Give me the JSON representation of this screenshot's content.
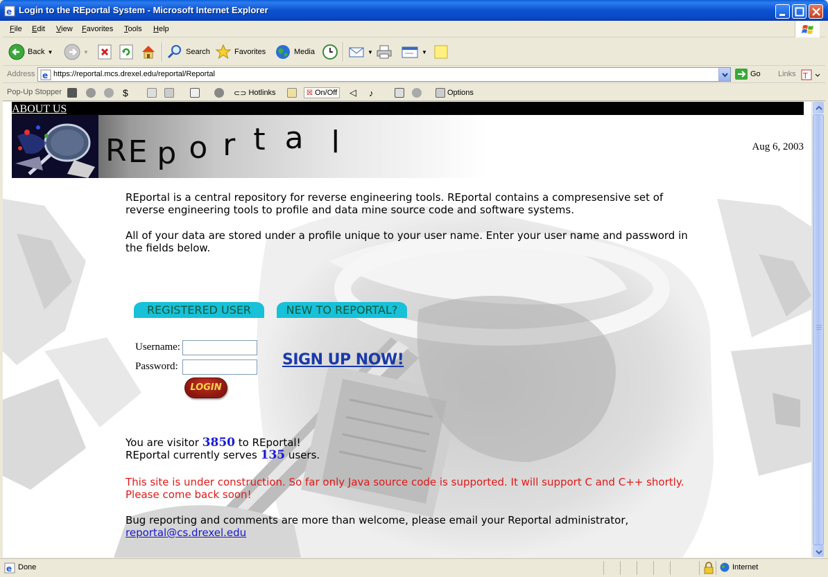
{
  "window": {
    "title": "Login to the REportal System - Microsoft Internet Explorer"
  },
  "menu": [
    "File",
    "Edit",
    "View",
    "Favorites",
    "Tools",
    "Help"
  ],
  "toolbar": {
    "back_label": "Back",
    "search_label": "Search",
    "favorites_label": "Favorites",
    "media_label": "Media"
  },
  "address": {
    "label": "Address",
    "url": "https://reportal.mcs.drexel.edu/reportal/Reportal",
    "go_label": "Go",
    "links_label": "Links"
  },
  "popup_bar": {
    "label": "Pop-Up Stopper",
    "hotlinks_label": "Hotlinks",
    "onoff_label": "On/Off",
    "options_label": "Options"
  },
  "page": {
    "about_link": "ABOUT US",
    "banner_letters": [
      "R",
      "E",
      "p",
      "o",
      "r",
      "t",
      "a",
      "l"
    ],
    "date": "Aug 6, 2003",
    "intro1": "REportal is a central repository for reverse engineering tools. REportal contains a compresensive set of reverse engineering tools to profile and data mine source code and software systems.",
    "intro2": "All of your data are stored under a profile unique to your user name. Enter your user name and password in the fields below.",
    "tab_registered": "REGISTERED USER",
    "tab_new": "NEW TO REPORTAL?",
    "username_label": "Username:",
    "password_label": "Password:",
    "username_value": "",
    "password_value": "",
    "login_label": "LOGIN",
    "signup_label": "SIGN UP NOW!",
    "visitor_prefix": "You are visitor ",
    "visitor_count": "3850",
    "visitor_suffix": " to REportal!",
    "users_prefix": "REportal currently serves ",
    "users_count": "135",
    "users_suffix": " users.",
    "warning": "This site is under construction. So far only Java source code is supported. It will support C and C++ shortly. Please come back soon!",
    "bug_text": "Bug reporting and comments are more than welcome, please email your Reportal administrator,",
    "email": "reportal@cs.drexel.edu"
  },
  "status": {
    "text": "Done",
    "zone": "Internet"
  },
  "colors": {
    "tab_bg": "#18c0d8",
    "tab_text": "#0d5a3c",
    "warning": "#e01818",
    "count": "#1818d8",
    "signup": "#1a3aa8",
    "login_bg": "#a02014"
  }
}
